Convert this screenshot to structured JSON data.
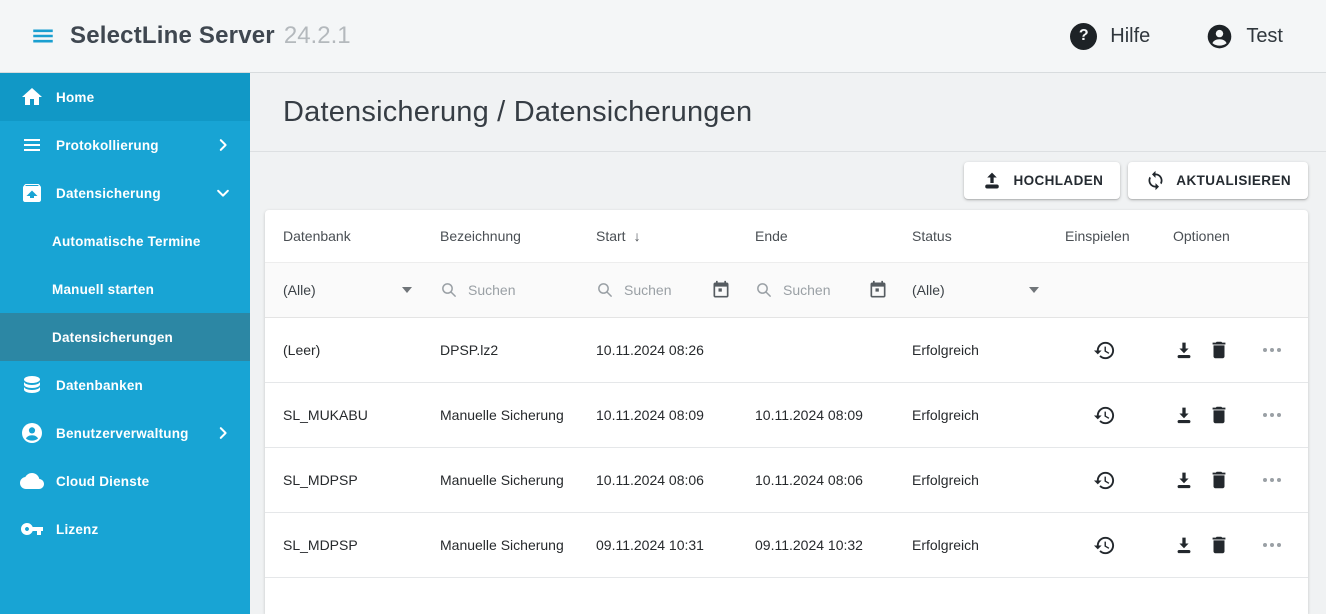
{
  "app": {
    "title": "SelectLine Server",
    "version": "24.2.1",
    "help_label": "Hilfe",
    "help_icon_glyph": "?",
    "user_label": "Test"
  },
  "sidebar": {
    "items": [
      {
        "label": "Home",
        "icon": "home-icon"
      },
      {
        "label": "Protokollierung",
        "icon": "list-icon",
        "chevron": "right"
      },
      {
        "label": "Datensicherung",
        "icon": "backup-icon",
        "chevron": "down",
        "expanded": true
      },
      {
        "label": "Automatische Termine",
        "sub": true
      },
      {
        "label": "Manuell starten",
        "sub": true
      },
      {
        "label": "Datensicherungen",
        "sub": true,
        "selected": true
      },
      {
        "label": "Datenbanken",
        "icon": "database-icon"
      },
      {
        "label": "Benutzerverwaltung",
        "icon": "account-icon",
        "chevron": "right"
      },
      {
        "label": "Cloud Dienste",
        "icon": "cloud-icon"
      },
      {
        "label": "Lizenz",
        "icon": "key-icon"
      }
    ]
  },
  "page": {
    "title": "Datensicherung / Datensicherungen"
  },
  "toolbar": {
    "upload_label": "HOCHLADEN",
    "upload_icon": "upload-icon",
    "refresh_label": "AKTUALISIEREN",
    "refresh_icon": "refresh-icon"
  },
  "table": {
    "headers": {
      "datenbank": "Datenbank",
      "bezeichnung": "Bezeichnung",
      "start": "Start",
      "ende": "Ende",
      "status": "Status",
      "einspielen": "Einspielen",
      "optionen": "Optionen"
    },
    "sort": {
      "column": "Start",
      "direction": "desc",
      "arrow": "↓"
    },
    "filters": {
      "datenbank": {
        "value": "(Alle)",
        "type": "dropdown"
      },
      "bezeichnung": {
        "placeholder": "Suchen",
        "value": "",
        "icons": [
          "search-icon"
        ]
      },
      "start": {
        "placeholder": "Suchen",
        "value": "",
        "icons": [
          "search-icon",
          "calendar-icon"
        ]
      },
      "ende": {
        "placeholder": "Suchen",
        "value": "",
        "icons": [
          "search-icon",
          "calendar-icon"
        ]
      },
      "status": {
        "value": "(Alle)",
        "type": "dropdown"
      }
    },
    "row_action_icons": {
      "einspielen": "restore-icon",
      "optionen": [
        "download-icon",
        "delete-icon",
        "more-options-icon"
      ]
    },
    "rows": [
      {
        "datenbank": "(Leer)",
        "bezeichnung": "DPSP.lz2",
        "start": "10.11.2024 08:26",
        "ende": "",
        "status": "Erfolgreich"
      },
      {
        "datenbank": "SL_MUKABU",
        "bezeichnung": "Manuelle Sicherung",
        "start": "10.11.2024 08:09",
        "ende": "10.11.2024 08:09",
        "status": "Erfolgreich"
      },
      {
        "datenbank": "SL_MDPSP",
        "bezeichnung": "Manuelle Sicherung",
        "start": "10.11.2024 08:06",
        "ende": "10.11.2024 08:06",
        "status": "Erfolgreich"
      },
      {
        "datenbank": "SL_MDPSP",
        "bezeichnung": "Manuelle Sicherung",
        "start": "09.11.2024 10:31",
        "ende": "09.11.2024 10:32",
        "status": "Erfolgreich"
      }
    ]
  },
  "colors": {
    "accent": "#18a4d4",
    "sidebar_bg": "#18a4d4",
    "sidebar_selected_bg": "#2c87a4",
    "page_bg": "#f0f2f3",
    "card_bg": "#ffffff",
    "topbar_icon_bg": "#1d2226"
  }
}
